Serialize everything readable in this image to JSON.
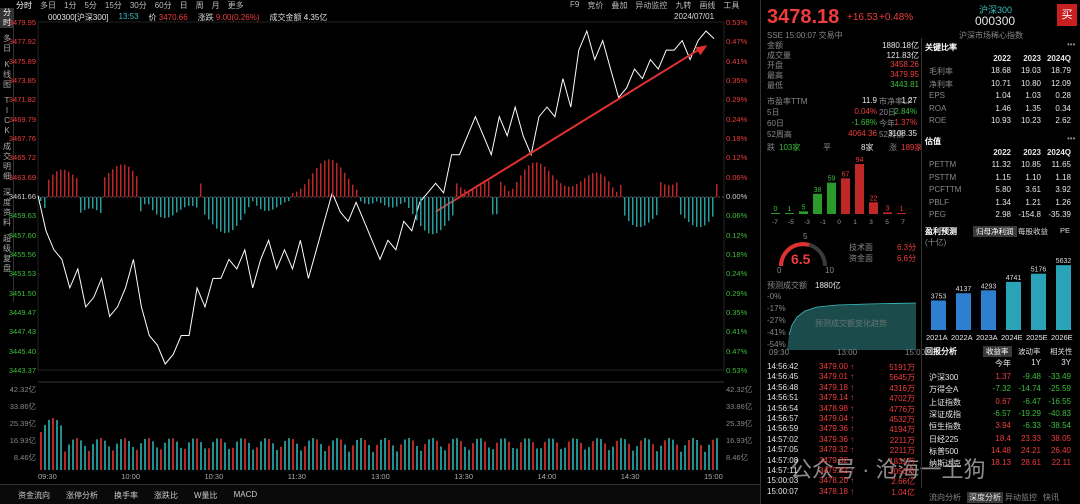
{
  "nav": {
    "left": [
      "分时",
      "多日",
      "K线图",
      "TICK",
      "成交明细",
      "深度资料",
      "超级复盘"
    ],
    "tabs": [
      "分时",
      "多日",
      "1分",
      "5分",
      "15分",
      "30分",
      "60分",
      "日",
      "周",
      "月",
      "更多"
    ],
    "tools": [
      "F9",
      "竞价",
      "叠加",
      "异动监控",
      "九转",
      "画线",
      "工具"
    ]
  },
  "info": {
    "name": "000300[沪深300]",
    "time": "13:53",
    "price_label": "价",
    "price": "3470.66",
    "chg_label": "涨跌",
    "chg": "9.00(0.26%)",
    "vol_label": "成交金额",
    "vol": "4.35亿",
    "date": "2024/07/01"
  },
  "yleft": [
    "3479.95",
    "3477.92",
    "3475.89",
    "3473.85",
    "3471.82",
    "3469.79",
    "3467.76",
    "3465.72",
    "3463.69",
    "3461.66",
    "3459.63",
    "3457.60",
    "3455.56",
    "3453.53",
    "3451.50",
    "3449.47",
    "3447.43",
    "3445.40",
    "3443.37"
  ],
  "yright": [
    "0.53%",
    "0.47%",
    "0.41%",
    "0.35%",
    "0.29%",
    "0.24%",
    "0.18%",
    "0.12%",
    "0.06%",
    "0.00%",
    "0.06%",
    "0.12%",
    "0.18%",
    "0.24%",
    "0.29%",
    "0.35%",
    "0.41%",
    "0.47%",
    "0.53%"
  ],
  "vleft": [
    "42.32亿",
    "33.86亿",
    "25.39亿",
    "16.93亿",
    "8.46亿"
  ],
  "xaxis": [
    "09:30",
    "10:00",
    "10:30",
    "11:30",
    "13:00",
    "13:30",
    "14:00",
    "14:30",
    "15:00"
  ],
  "bottom": [
    "资金流向",
    "涨停分析",
    "换手率",
    "涨跌比",
    "W量比",
    "MACD"
  ],
  "watermark": "公众号 · 沧海一土狗",
  "rp": {
    "price": "3478.18",
    "chg": "+16.53",
    "pct": "+0.48%",
    "name": "沪深300",
    "code": "000300",
    "buy": "买",
    "sub": "SSE  15:00:07  交易中",
    "sub2": "沪深市场稀心指数",
    "kv": [
      [
        "金额",
        "1880.18亿"
      ],
      [
        "成交量",
        "121.83亿"
      ],
      [
        "开盘",
        "3458.26"
      ],
      [
        "最高",
        "3479.95"
      ],
      [
        "最低",
        "3443.81"
      ]
    ],
    "pe": [
      [
        "市盈率TTM",
        "11.9",
        "市净率LF",
        "1.27"
      ],
      [
        "5日",
        "0.04%",
        "20日",
        "-2.84%"
      ],
      [
        "60日",
        "-1.68%",
        "今年",
        "1.37%"
      ],
      [
        "52周高",
        "4064.36",
        "52周低",
        "3108.35"
      ]
    ],
    "dist_sum": {
      "down": "跌",
      "down_n": "103家",
      "flat": "平",
      "flat_n": "8家",
      "up": "涨",
      "up_n": "189家"
    },
    "dist_labels": [
      "-7",
      "-5",
      "-3",
      "-1",
      "0",
      "1",
      "3",
      "5",
      "7"
    ],
    "dist_vals": [
      "0",
      "1",
      "5",
      "38",
      "59",
      "67",
      "94",
      "22",
      "3",
      "1"
    ],
    "score": "6.5",
    "tech_label": "技术面",
    "tech": "6.3分",
    "fund_label": "资金面",
    "fund": "6.6分",
    "scale": [
      "0",
      "5",
      "10"
    ],
    "fc_label": "预测成交额",
    "fc": "1880亿",
    "fc_y": [
      "-0%",
      "-17%",
      "-27%",
      "-41%",
      "-54%"
    ],
    "fc_x": [
      "09:30",
      "13:00",
      "15:00"
    ],
    "fc_watermark": "预测成交额变化趋势",
    "ticks": [
      [
        "14:56:42",
        "3479.00",
        "5191万"
      ],
      [
        "14:56:45",
        "3479.01",
        "5645万"
      ],
      [
        "14:56:48",
        "3479.18",
        "4316万"
      ],
      [
        "14:56:51",
        "3479.14",
        "4702万"
      ],
      [
        "14:56:54",
        "3478.98",
        "4776万"
      ],
      [
        "14:56:57",
        "3479.04",
        "4532万"
      ],
      [
        "14:56:59",
        "3479.36",
        "4194万"
      ],
      [
        "14:57:02",
        "3479.36",
        "2211万"
      ],
      [
        "14:57:05",
        "3479.32",
        "2211万"
      ],
      [
        "14:57:08",
        "3479.32",
        "1831万"
      ],
      [
        "14:57:11",
        "3479.32",
        "1056万"
      ],
      [
        "15:00:03",
        "3478.20",
        "2.66亿"
      ],
      [
        "15:00:07",
        "3478.18",
        "1.04亿"
      ]
    ],
    "kr_title": "关键比率",
    "kr_head": [
      "2022",
      "2023",
      "2024Q"
    ],
    "kr": [
      [
        "毛利率",
        "18.68",
        "19.03",
        "18.79"
      ],
      [
        "净利率",
        "10.71",
        "10.80",
        "12.09"
      ],
      [
        "EPS",
        "1.04",
        "1.03",
        "0.28"
      ],
      [
        "ROA",
        "1.46",
        "1.35",
        "0.34"
      ],
      [
        "ROE",
        "10.93",
        "10.23",
        "2.62"
      ]
    ],
    "val_title": "估值",
    "val_head": [
      "2022",
      "2023",
      "2024Q"
    ],
    "val": [
      [
        "PETTM",
        "11.32",
        "10.85",
        "11.65"
      ],
      [
        "PSTTM",
        "1.15",
        "1.10",
        "1.18"
      ],
      [
        "PCFTTM",
        "5.80",
        "3.61",
        "3.92"
      ],
      [
        "PBLF",
        "1.34",
        "1.21",
        "1.26"
      ],
      [
        "PEG",
        "2.98",
        "-154.8",
        "-35.39"
      ]
    ],
    "ep_title": "盈利预测",
    "ep_unit": "(十亿)",
    "ep_tabs": [
      "归母净利润",
      "每股收益",
      "PE"
    ],
    "ep_vals": [
      "3753",
      "4137",
      "4293",
      "4741",
      "5176",
      "5632"
    ],
    "ep_years": [
      "2021A",
      "2022A",
      "2023A",
      "2024E",
      "2025E",
      "2026E"
    ],
    "ra_title": "回报分析",
    "ra_tabs": [
      "收益率",
      "波动率",
      "相关性"
    ],
    "ra_head": [
      "今年",
      "1Y",
      "3Y"
    ],
    "ra": [
      [
        "沪深300",
        "1.37",
        "-9.48",
        "-33.49"
      ],
      [
        "万得全A",
        "-7.32",
        "-14.74",
        "-25.59"
      ],
      [
        "上证指数",
        "0.67",
        "-6.47",
        "-16.55"
      ],
      [
        "深证成指",
        "-6.57",
        "-19.29",
        "-40.83"
      ],
      [
        "恒生指数",
        "3.94",
        "-6.33",
        "-38.54"
      ],
      [
        "日经225",
        "18.4",
        "23.33",
        "38.05"
      ],
      [
        "标普500",
        "14.48",
        "24.21",
        "26.40"
      ],
      [
        "纳斯达克",
        "18.13",
        "28.61",
        "22.11"
      ]
    ],
    "rb_tabs": [
      "流向分析",
      "深度分析",
      "异动监控",
      "快讯"
    ]
  },
  "colors": {
    "up": "#f03c3c",
    "down": "#3dbd3d",
    "line": "#ffffff",
    "arrow": "#e03030",
    "vol": "#2fb0b0"
  }
}
